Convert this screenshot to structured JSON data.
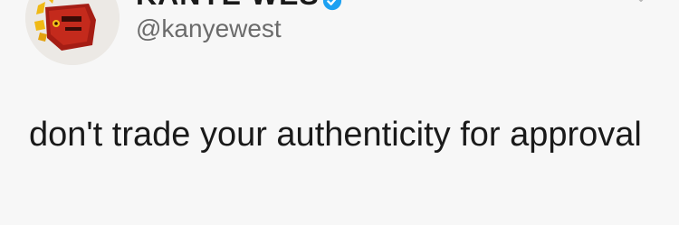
{
  "tweet": {
    "author": {
      "display_name": "KANYE WEST",
      "handle": "@kanyewest",
      "verified": true,
      "avatar_icon": "crowned-portrait-avatar"
    },
    "text": "don't trade your authenticity for approval",
    "menu_icon": "chevron-down-icon"
  },
  "colors": {
    "background": "#f7f7f7",
    "text": "#1a1a1a",
    "handle": "#6b6b6b",
    "verified": "#1da1f2"
  }
}
